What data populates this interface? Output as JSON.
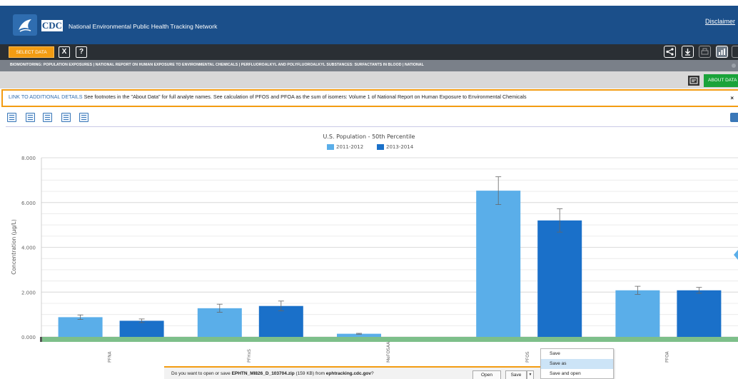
{
  "header": {
    "agency": "CDC",
    "title": "National Environmental Public Health Tracking Network",
    "disclaimer": "Disclaimer",
    "logo_icon": "hhs-eagle-icon"
  },
  "toolbar": {
    "select_data": "SELECT DATA",
    "clear_label": "X",
    "help_label": "?",
    "right_icons": [
      "share-icon",
      "download-icon",
      "print-icon",
      "chart-icon",
      "table-icon"
    ]
  },
  "breadcrumb": "BIOMONITORING: POPULATION EXPOSURES | NATIONAL REPORT ON HUMAN EXPOSURE TO ENVIRONMENTAL CHEMICALS | PERFLUOROALKYL AND POLYFLUOROALKYL SUBSTANCES: SURFACTANTS IN BLOOD | NATIONAL",
  "about": {
    "label": "ABOUT DATA"
  },
  "notice": {
    "link": "LINK TO ADDITIONAL DETAILS",
    "text": " See footnotes in the \"About Data\" for full analyte names. See calculation of PFOS and PFOA as the sum of isomers: Volume 1 of National Report on Human Exposure to Environmental Chemicals",
    "close": "×"
  },
  "chart_data": {
    "type": "bar",
    "title": "U.S. Population - 50th Percentile",
    "ylabel": "Concentration (µg/L)",
    "xlabel": "",
    "ylim": [
      0,
      8
    ],
    "yticks": [
      "0.000",
      "2.000",
      "4.000",
      "6.000",
      "8.000"
    ],
    "categories": [
      "PFNA",
      "PFHxS",
      "MeFOSAA",
      "PFOS",
      "PFOA"
    ],
    "series": [
      {
        "name": "2011-2012",
        "color": "#5aaee9",
        "values": [
          0.88,
          1.28,
          0.14,
          6.53,
          2.08
        ],
        "err": [
          0.1,
          0.18,
          0.02,
          0.62,
          0.18
        ]
      },
      {
        "name": "2013-2014",
        "color": "#1a70c9",
        "values": [
          0.72,
          1.38,
          null,
          5.2,
          2.08
        ],
        "err": [
          0.08,
          0.22,
          null,
          0.52,
          0.13
        ]
      }
    ],
    "legend_position": "top-center",
    "grid": true
  },
  "download": {
    "message_prefix": "Do you want to open or save ",
    "filename": "EPHTN_MI826_D_103704.zip",
    "size": " (159 KB) from ",
    "site": "ephtracking.cdc.gov",
    "suffix": "?",
    "open": "Open",
    "save": "Save"
  },
  "save_menu": [
    "Save",
    "Save as",
    "Save and open"
  ]
}
